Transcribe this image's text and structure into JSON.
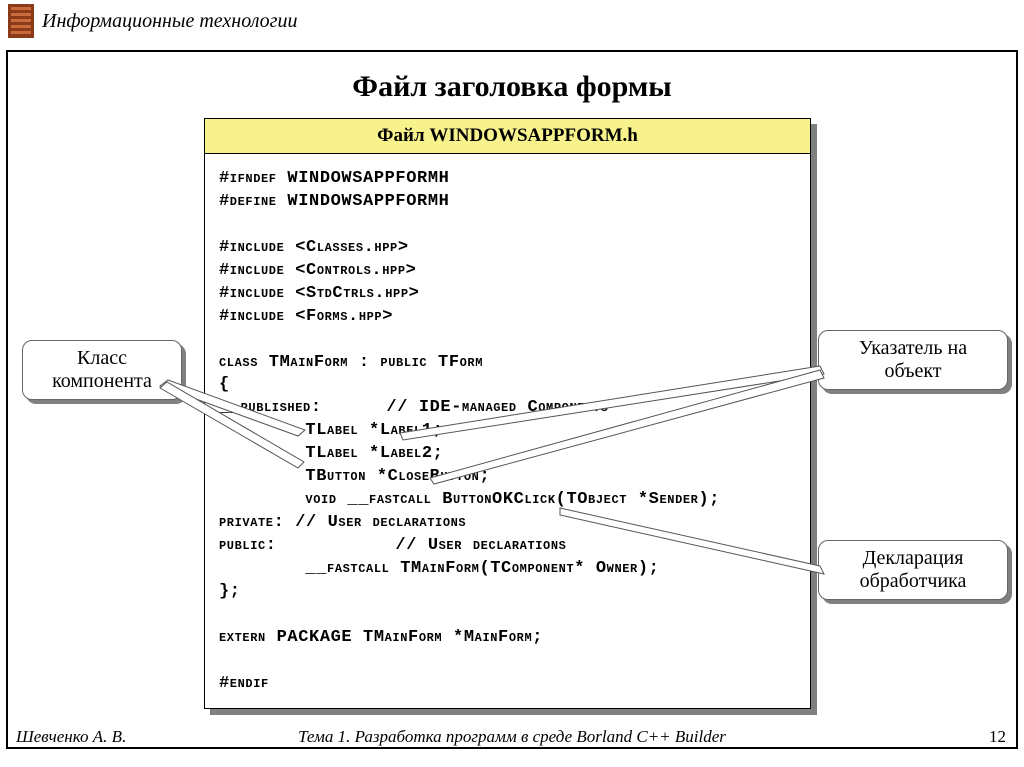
{
  "header": {
    "title": "Информационные технологии"
  },
  "slide": {
    "title": "Файл заголовка формы"
  },
  "panel": {
    "title": "Файл WINDOWSAPPFORM.h",
    "code": "#ifndef WINDOWSAPPFORMH\n#define WINDOWSAPPFORMH\n\n#include <Classes.hpp>\n#include <Controls.hpp>\n#include <StdCtrls.hpp>\n#include <Forms.hpp>\n\nclass TMainForm : public TForm\n{\n__published:      // IDE-managed Components\n        TLabel *Label1;\n        TLabel *Label2;\n        TButton *CloseButton;\n        void __fastcall ButtonOKClick(TObject *Sender);\nprivate: // User declarations\npublic:           // User declarations\n        __fastcall TMainForm(TComponent* Owner);\n};\n\nextern PACKAGE TMainForm *MainForm;\n\n#endif"
  },
  "callouts": {
    "class_component": "Класс\nкомпонента",
    "pointer_object": "Указатель на\nобъект",
    "handler_declaration": "Декларация\nобработчика"
  },
  "footer": {
    "author": "Шевченко А. В.",
    "topic": "Тема 1. Разработка программ в среде Borland C++ Builder",
    "page": "12"
  }
}
